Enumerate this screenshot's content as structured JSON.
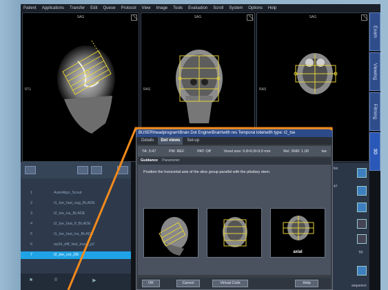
{
  "menubar": {
    "items": [
      "Patient",
      "Applications",
      "Transfer",
      "Edit",
      "Queue",
      "Protocol",
      "View",
      "Image",
      "Tools",
      "Evaluation",
      "Scroll",
      "System",
      "Options",
      "Help"
    ]
  },
  "viewports": [
    {
      "top": "SAG",
      "side": "RTL"
    },
    {
      "top": "SAG",
      "side": "RAS"
    },
    {
      "top": "SAG",
      "side": "RAS"
    }
  ],
  "side_tabs": [
    "Exam",
    "Viewing",
    "Filming",
    "3D"
  ],
  "exam_list": [
    {
      "num": "1",
      "name": "AutoAlign_Scout"
    },
    {
      "num": "2",
      "name": "t1_tse_fast_sag_BLADE"
    },
    {
      "num": "3",
      "name": "t2_tse_tra_BLADE"
    },
    {
      "num": "4",
      "name": "t2_tse_fast_fl_BLADE"
    },
    {
      "num": "5",
      "name": "t1_tse_fast_tra_BLADE"
    },
    {
      "num": "6",
      "name": "ep2d_diff_fast_trace_p2"
    },
    {
      "num": "7",
      "name": "t2_tse_cor_DE"
    }
  ],
  "exam_selected_index": 6,
  "exam_bottom": [
    "■",
    "II",
    "▶"
  ],
  "dialog": {
    "title": "BUSER\\headprogram\\Brain Dot Engine\\Brain\\with res Temporal lobe\\with type: t2_tse",
    "tabs": [
      "Details",
      "Dot views",
      "Set-up"
    ],
    "active_tab": 1,
    "info": {
      "ta": "TA: 3:47",
      "pm": "PM: REF",
      "pat": "PAT: Off",
      "voxel": "Voxel size: 0.8×0.8×3.0 mm",
      "snr": "Rel. SNR: 1.00",
      "seq": "tse"
    },
    "sub_tabs": [
      "Guidance",
      "Parameter"
    ],
    "active_sub_tab": 0,
    "guidance_text": "Position the horizontal axis of the slice group parallel with the pituitary stem.",
    "images": [
      {
        "caption": ""
      },
      {
        "caption": ""
      },
      {
        "caption": "axial"
      }
    ],
    "buttons": [
      "OK",
      "Cancel",
      "Virtual Coils",
      "Help"
    ]
  },
  "right_panel": {
    "labels": [
      "list",
      "47",
      "TR",
      "sequence"
    ]
  },
  "colors": {
    "accent_blue": "#2d4b88",
    "selection": "#1fa3e6",
    "callout": "#f28a1c",
    "overlay_yellow": "#e6d23a"
  }
}
